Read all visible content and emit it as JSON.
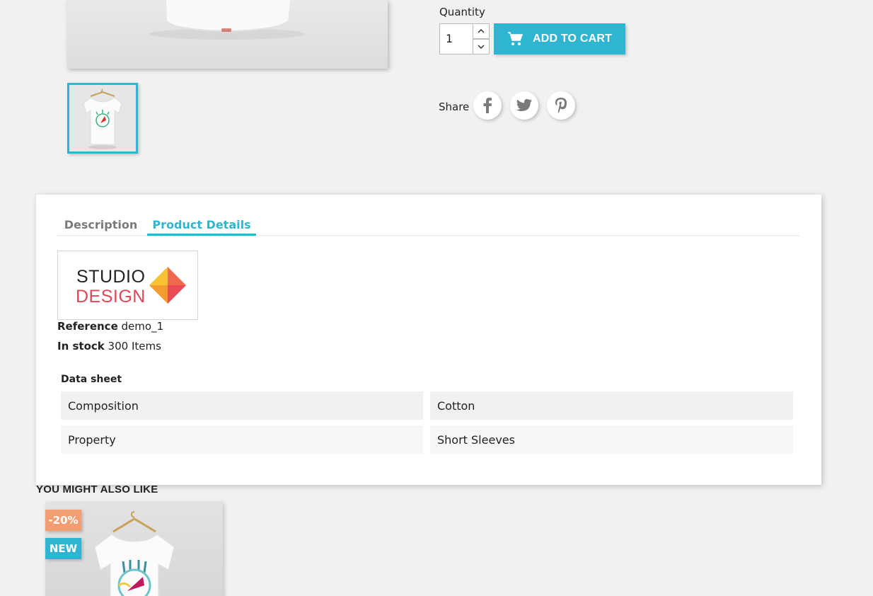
{
  "product": {
    "quantity_label": "Quantity",
    "quantity_value": "1",
    "add_to_cart_label": "ADD TO CART",
    "share_label": "Share",
    "social": [
      "facebook-icon",
      "twitter-icon",
      "pinterest-icon"
    ]
  },
  "tabs": [
    {
      "label": "Description",
      "active": false
    },
    {
      "label": "Product Details",
      "active": true
    }
  ],
  "details": {
    "brand_logo_line1": "STUDIO",
    "brand_logo_line2": "DESIGN",
    "reference_label": "Reference",
    "reference_value": "demo_1",
    "stock_label": "In stock",
    "stock_value": "300 Items",
    "datasheet_title": "Data sheet",
    "datasheet": [
      {
        "name": "Composition",
        "value": "Cotton"
      },
      {
        "name": "Property",
        "value": "Short Sleeves"
      }
    ]
  },
  "related": {
    "title": "YOU MIGHT ALSO LIKE",
    "flags": [
      "-20%",
      "NEW"
    ]
  },
  "colors": {
    "accent": "#2fb5d2",
    "discount": "#f39d72",
    "background": "#f1f1f1"
  }
}
